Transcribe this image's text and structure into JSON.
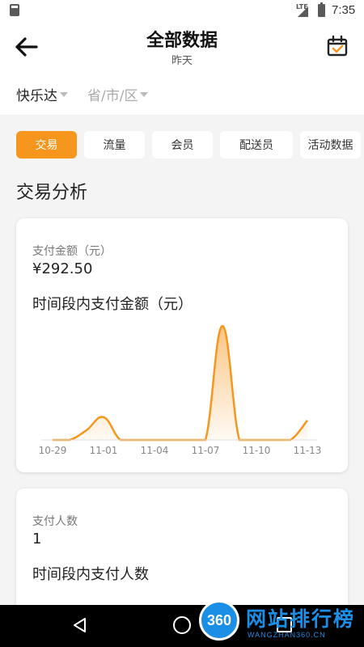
{
  "status_bar": {
    "network": "LTE",
    "time": "7:35"
  },
  "header": {
    "title": "全部数据",
    "subtitle": "昨天",
    "back_icon": "arrow-left-icon",
    "calendar_icon": "calendar-check-icon"
  },
  "filters": {
    "store": "快乐达",
    "region": "省/市/区"
  },
  "tabs": [
    {
      "label": "交易",
      "active": true
    },
    {
      "label": "流量",
      "active": false
    },
    {
      "label": "会员",
      "active": false
    },
    {
      "label": "配送员",
      "active": false
    },
    {
      "label": "活动数据",
      "active": false
    }
  ],
  "section_title": "交易分析",
  "cards": [
    {
      "metric_label": "支付金额（元）",
      "metric_value": "¥292.50",
      "chart_title": "时间段内支付金额（元）"
    },
    {
      "metric_label": "支付人数",
      "metric_value": "1",
      "chart_title": "时间段内支付人数"
    }
  ],
  "colors": {
    "accent": "#f6961d",
    "watermark": "#1b8fe6"
  },
  "chart_data": {
    "type": "area",
    "x": [
      "10-29",
      "10-30",
      "10-31",
      "11-01",
      "11-02",
      "11-03",
      "11-04",
      "11-05",
      "11-06",
      "11-07",
      "11-08",
      "11-09",
      "11-10",
      "11-11",
      "11-12",
      "11-13"
    ],
    "values": [
      0,
      0,
      12,
      28,
      0,
      0,
      0,
      0,
      0,
      0,
      140,
      0,
      0,
      0,
      0,
      24
    ],
    "x_tick_labels": [
      "10-29",
      "11-01",
      "11-04",
      "11-07",
      "11-10",
      "11-13"
    ],
    "ylim": [
      0,
      145
    ],
    "grid": false,
    "color": "#f6961d"
  },
  "nav_bar": {
    "back_icon": "triangle-back-icon",
    "home_icon": "circle-home-icon",
    "recent_icon": "square-recent-icon"
  },
  "watermark": {
    "badge": "360",
    "text": "网站排行榜",
    "sub": "WANGZHAN360.CN"
  }
}
